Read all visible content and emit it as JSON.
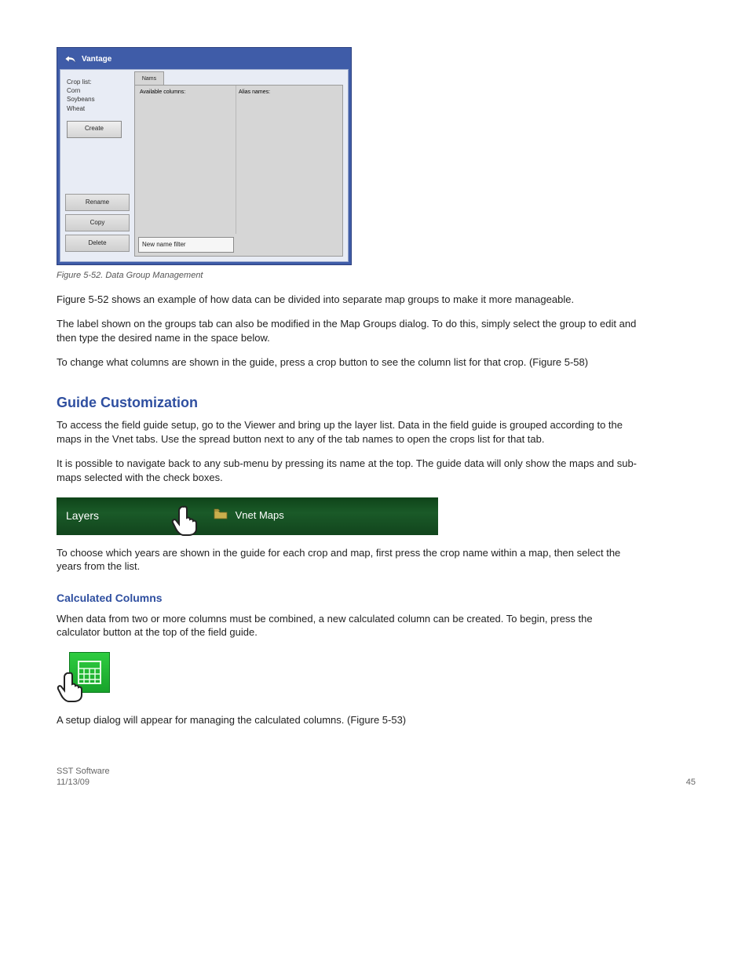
{
  "dialog": {
    "title": "Vantage",
    "sidebar_header": "Crop list:",
    "sidebar_items": [
      "Corn",
      "Soybeans",
      "Wheat"
    ],
    "create_label": "Create",
    "low_buttons": [
      "Rename",
      "Copy",
      "Delete"
    ],
    "tab_label": "Nams",
    "col1_label": "Available columns:",
    "col2_label": "Alias names:",
    "filter_label": "New name filter"
  },
  "figure_caption": "Figure 5-52. Data Group Management",
  "paragraphs": {
    "p1": "Figure 5-52 shows an example of how data can be divided into separate map groups to make it more manageable.",
    "p2": "The label shown on the groups tab can also be modified in the Map Groups dialog. To do this, simply select the group to edit and then type the desired name in the space below.",
    "p3": "To change what columns are shown in the guide, press a crop button to see the column list for that crop. (Figure 5-58)"
  },
  "sections": {
    "customization_title": "Guide Customization",
    "customization_p1": "To access the field guide setup, go to the Viewer and bring up the layer list. Data in the field guide is grouped according to the maps in the Vnet tabs. Use the spread button next to any of the tab names to open the crops list for that tab.",
    "customization_p2": "It is possible to navigate back to any sub-menu by pressing its name at the top. The guide data will only show the maps and sub-maps selected with the check boxes.",
    "afterbar_p": "To choose which years are shown in the guide for each crop and map, first press the crop name within a map, then select the years from the list.",
    "calc_title": "Calculated Columns",
    "calc_p": "When data from two or more columns must be combined, a new calculated column can be created. To begin, press the calculator button at the top of the field guide.",
    "aftercalc_p": "A setup dialog will appear for managing the calculated columns. (Figure 5-53)"
  },
  "greenbar": {
    "left_label": "Layers",
    "folder_text": "Vnet Maps"
  },
  "footer": {
    "company": "SST Software",
    "date": "11/13/09",
    "page": "45"
  }
}
